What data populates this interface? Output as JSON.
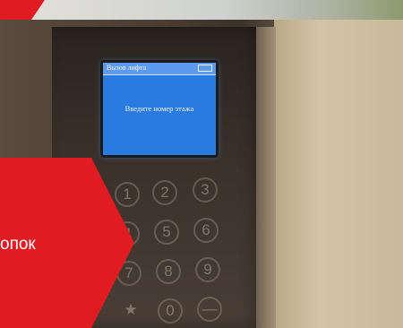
{
  "screen": {
    "title": "Вызов лифта",
    "message": "Введите номер этажа"
  },
  "keypad": {
    "keys": [
      "1",
      "2",
      "3",
      "4",
      "5",
      "6",
      "7",
      "8",
      "9",
      "★",
      "0",
      "—"
    ]
  },
  "badge": {
    "text": "опок"
  },
  "colors": {
    "badge": "#e11b22",
    "screen": "#2a7be0"
  }
}
